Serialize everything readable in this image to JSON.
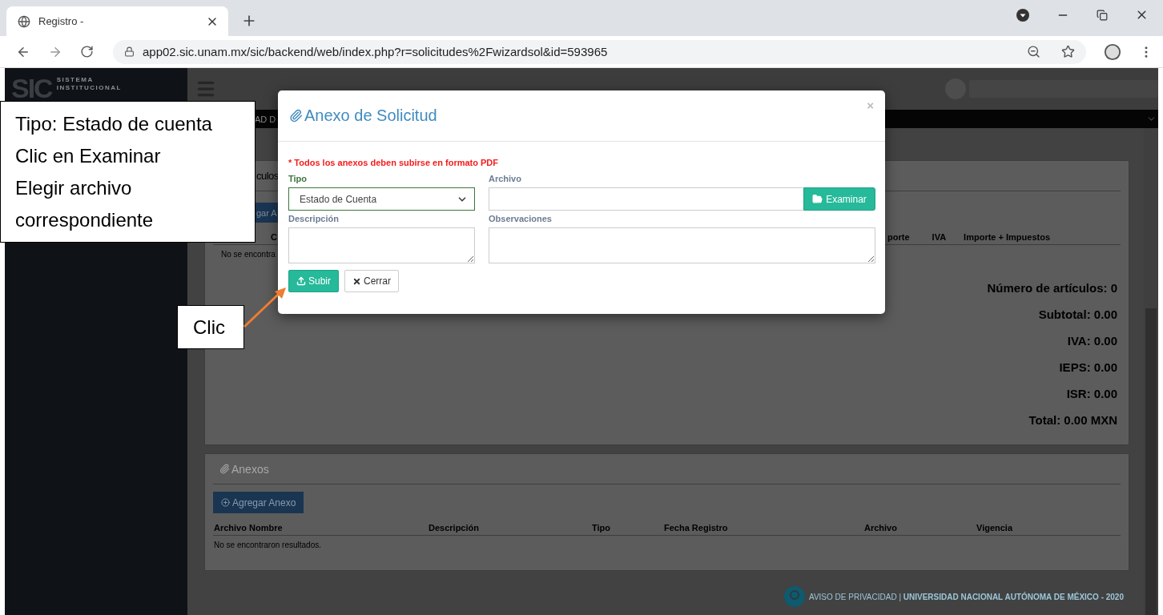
{
  "browser": {
    "tab_title": "Registro -",
    "url": "app02.sic.unam.mx/sic/backend/web/index.php?r=solicitudes%2Fwizardsol&id=593965"
  },
  "sidebar": {
    "logo": "SIC",
    "logo_lines": [
      "SISTEMA",
      "INSTITUCIONAL"
    ]
  },
  "top_bar_fragment": "AD D",
  "articles_panel": {
    "title_fragment": "culos",
    "button_fragment": "gar A",
    "first_column_fragment": "C",
    "columns": [
      "porte",
      "IVA",
      "Importe + Impuestos"
    ],
    "empty_fragment": "No se encontra",
    "totals": [
      "Número de artículos: 0",
      "Subtotal: 0.00",
      "IVA: 0.00",
      "IEPS: 0.00",
      "ISR: 0.00",
      "Total: 0.00 MXN"
    ]
  },
  "annexes_panel": {
    "title": "Anexos",
    "button": "Agregar Anexo",
    "columns": [
      "Archivo Nombre",
      "Descripción",
      "Tipo",
      "Fecha Registro",
      "Archivo",
      "Vigencia"
    ],
    "empty": "No se encontraron resultados."
  },
  "footer": "AVISO DE PRIVACIDAD | **UNIVERSIDAD NACIONAL AUTÓNOMA DE MÉXICO - 2020**",
  "modal": {
    "title": "Anexo de Solicitud",
    "close": "×",
    "note": "* Todos los anexos deben subirse en formato PDF",
    "fields": [
      {
        "kind": "select",
        "label": "Tipo",
        "value": "Estado de Cuenta",
        "valid": true
      },
      {
        "kind": "file",
        "label": "Archivo",
        "button": "Examinar",
        "valid": false
      },
      {
        "kind": "textarea",
        "label": "Descripción",
        "valid": false
      },
      {
        "kind": "textarea",
        "label": "Observaciones",
        "valid": false
      }
    ],
    "buttons": [
      {
        "kind": "primary",
        "label": "Subir"
      },
      {
        "kind": "default",
        "label": "Cerrar"
      }
    ]
  },
  "callouts": [
    {
      "lines": [
        "Tipo: Estado de cuenta",
        "Clic en Examinar",
        "Elegir archivo",
        "correspondiente"
      ]
    },
    {
      "lines": [
        "Clic"
      ]
    }
  ]
}
